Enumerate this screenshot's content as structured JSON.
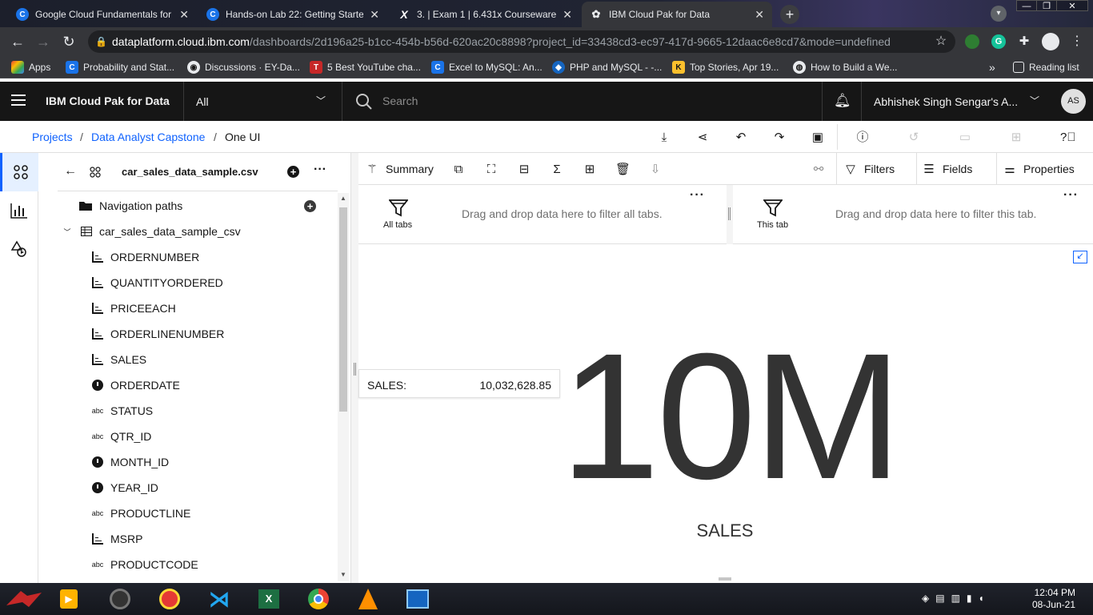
{
  "browser": {
    "tabs": [
      {
        "title": "Google Cloud Fundamentals for ",
        "favicon": "coursera-icon",
        "color": "#1a73e8"
      },
      {
        "title": "Hands-on Lab 22: Getting Starte",
        "favicon": "coursera-icon",
        "color": "#1a73e8"
      },
      {
        "title": "3. | Exam 1 | 6.431x Courseware |",
        "favicon": "edx-icon",
        "color": "#222"
      },
      {
        "title": "IBM Cloud Pak for Data",
        "favicon": "ibm-icon",
        "color": "#35363a"
      }
    ],
    "new_tab_label": "+",
    "url_domain": "dataplatform.cloud.ibm.com",
    "url_path": "/dashboards/2d196a25-b1cc-454b-b56d-620ac20c8898?project_id=33438cd3-ec97-417d-9665-12daac6e8cd7&mode=undefined",
    "bookmarks": [
      {
        "label": "Apps"
      },
      {
        "label": "Probability and Stat..."
      },
      {
        "label": "Discussions · EY-Da..."
      },
      {
        "label": "5 Best YouTube cha..."
      },
      {
        "label": "Excel to MySQL: An..."
      },
      {
        "label": "PHP and MySQL - -..."
      },
      {
        "label": "Top Stories, Apr 19..."
      },
      {
        "label": "How to Build a We..."
      }
    ],
    "bookmarks_more": "»",
    "reading_list": "Reading list"
  },
  "app_header": {
    "brand": "IBM Cloud Pak for Data",
    "context": "All",
    "search_placeholder": "Search",
    "user": "Abhishek Singh Sengar's A...",
    "avatar": "AS"
  },
  "breadcrumb": {
    "items": [
      "Projects",
      "Data Analyst Capstone",
      "One UI"
    ],
    "separator": "/"
  },
  "data_panel": {
    "file_name": "car_sales_data_sample.csv",
    "nav_paths_label": "Navigation paths",
    "table_name": "car_sales_data_sample_csv",
    "fields": [
      {
        "name": "ORDERNUMBER",
        "type": "measure"
      },
      {
        "name": "QUANTITYORDERED",
        "type": "measure"
      },
      {
        "name": "PRICEEACH",
        "type": "measure"
      },
      {
        "name": "ORDERLINENUMBER",
        "type": "measure"
      },
      {
        "name": "SALES",
        "type": "measure"
      },
      {
        "name": "ORDERDATE",
        "type": "time"
      },
      {
        "name": "STATUS",
        "type": "text"
      },
      {
        "name": "QTR_ID",
        "type": "text"
      },
      {
        "name": "MONTH_ID",
        "type": "time"
      },
      {
        "name": "YEAR_ID",
        "type": "time"
      },
      {
        "name": "PRODUCTLINE",
        "type": "text"
      },
      {
        "name": "MSRP",
        "type": "measure"
      },
      {
        "name": "PRODUCTCODE",
        "type": "text"
      }
    ],
    "text_badge": "abc"
  },
  "toolbar": {
    "summary_label": "Summary",
    "filters_label": "Filters",
    "fields_label": "Fields",
    "properties_label": "Properties"
  },
  "filter_bar": {
    "all_tabs_label": "All tabs",
    "all_tabs_drop": "Drag and drop data here to filter all tabs.",
    "this_tab_label": "This tab",
    "this_tab_drop": "Drag and drop data here to filter this tab.",
    "more": "···"
  },
  "visualization": {
    "tooltip_label": "SALES:",
    "tooltip_value": "10,032,628.85",
    "summary_value": "10M",
    "summary_label": "SALES"
  },
  "taskbar": {
    "time": "12:04 PM",
    "date": "08-Jun-21"
  }
}
